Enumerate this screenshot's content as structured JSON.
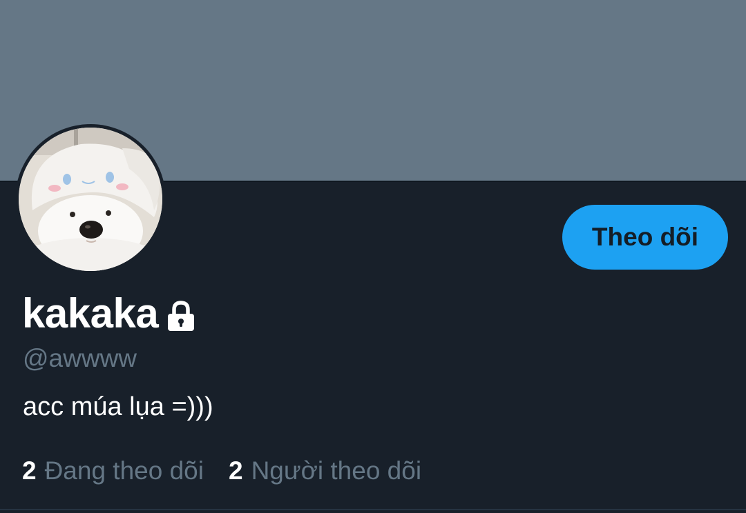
{
  "profile": {
    "display_name": "kakaka",
    "handle": "@awwww",
    "bio": "acc múa lụa =)))",
    "protected": true,
    "avatar_icon": "dog-wearing-hood-photo"
  },
  "actions": {
    "follow_label": "Theo dõi"
  },
  "stats": {
    "following_count": "2",
    "following_label": "Đang theo dõi",
    "followers_count": "2",
    "followers_label": "Người theo dõi"
  },
  "colors": {
    "banner": "#657786",
    "background": "#18202a",
    "accent": "#1da1f2",
    "muted_text": "#657786"
  }
}
